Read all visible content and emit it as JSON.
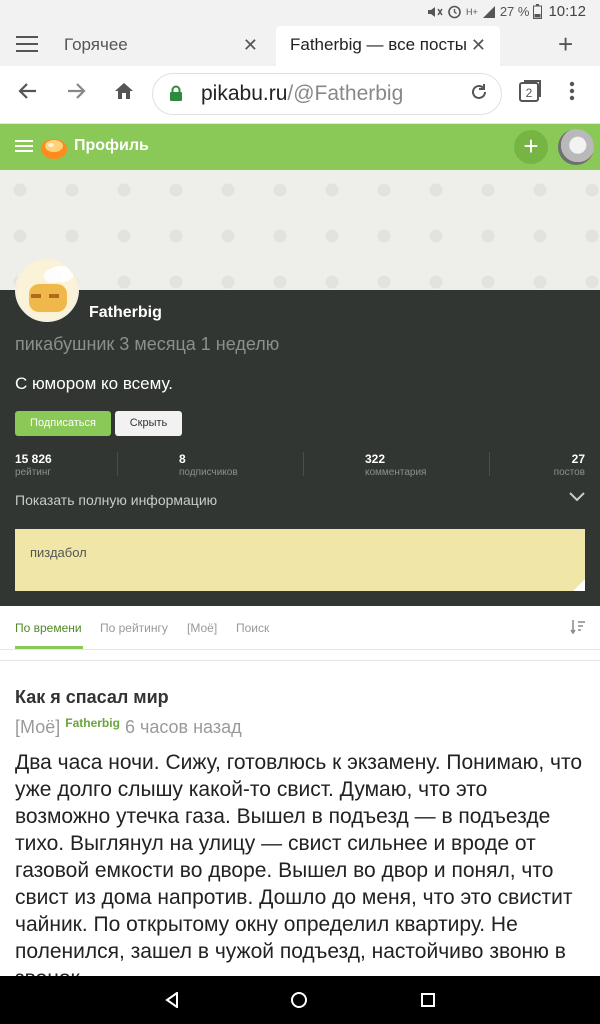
{
  "status_bar": {
    "battery": "27 %",
    "time": "10:12",
    "network": "H+",
    "icons": [
      "mute-icon",
      "alarm-icon",
      "signal-icon",
      "battery-icon"
    ]
  },
  "tabs": [
    {
      "label": "Горячее",
      "active": false
    },
    {
      "label": "Fatherbig — все посты",
      "active": true
    }
  ],
  "toolbar": {
    "url_host": "pikabu.ru",
    "url_path": "/@Fatherbig",
    "tab_count": "2"
  },
  "site_header": {
    "title": "Профиль"
  },
  "profile": {
    "username": "Fatherbig",
    "since": "пикабушник 3 месяца 1 неделю",
    "bio": "С юмором ко всему.",
    "subscribe_label": "Подписаться",
    "hide_label": "Скрыть",
    "stats": [
      {
        "value": "15 826",
        "label": "рейтинг"
      },
      {
        "value": "8",
        "label": "подписчиков"
      },
      {
        "value": "322",
        "label": "комментария"
      },
      {
        "value": "27",
        "label": "постов"
      }
    ],
    "show_info_label": "Показать полную информацию",
    "note_text": "пиздабол"
  },
  "sort": {
    "items": [
      "По времени",
      "По рейтингу",
      "[Моё]",
      "Поиск"
    ]
  },
  "post": {
    "title": "Как я спасал мир",
    "tag": "[Моё]",
    "author": "Fatherbig",
    "time": "6 часов назад",
    "body": "Два часа ночи. Сижу, готовлюсь к экзамену. Понимаю, что уже долго слышу какой-то свист. Думаю, что это возможно утечка газа. Вышел в подъезд — в подъезде тихо. Выглянул на улицу — свист сильнее и вроде от газовой емкости во дворе. Вышел во двор и понял, что свист из дома напротив. Дошло до меня, что это свистит чайник. По открытому окну определил квартиру.  Не поленился, зашел в чужой подъезд, настойчиво звоню в звонок"
  },
  "colors": {
    "brand_green": "#8ac858",
    "profile_bg": "#323633",
    "note_bg": "#efe6a8"
  }
}
